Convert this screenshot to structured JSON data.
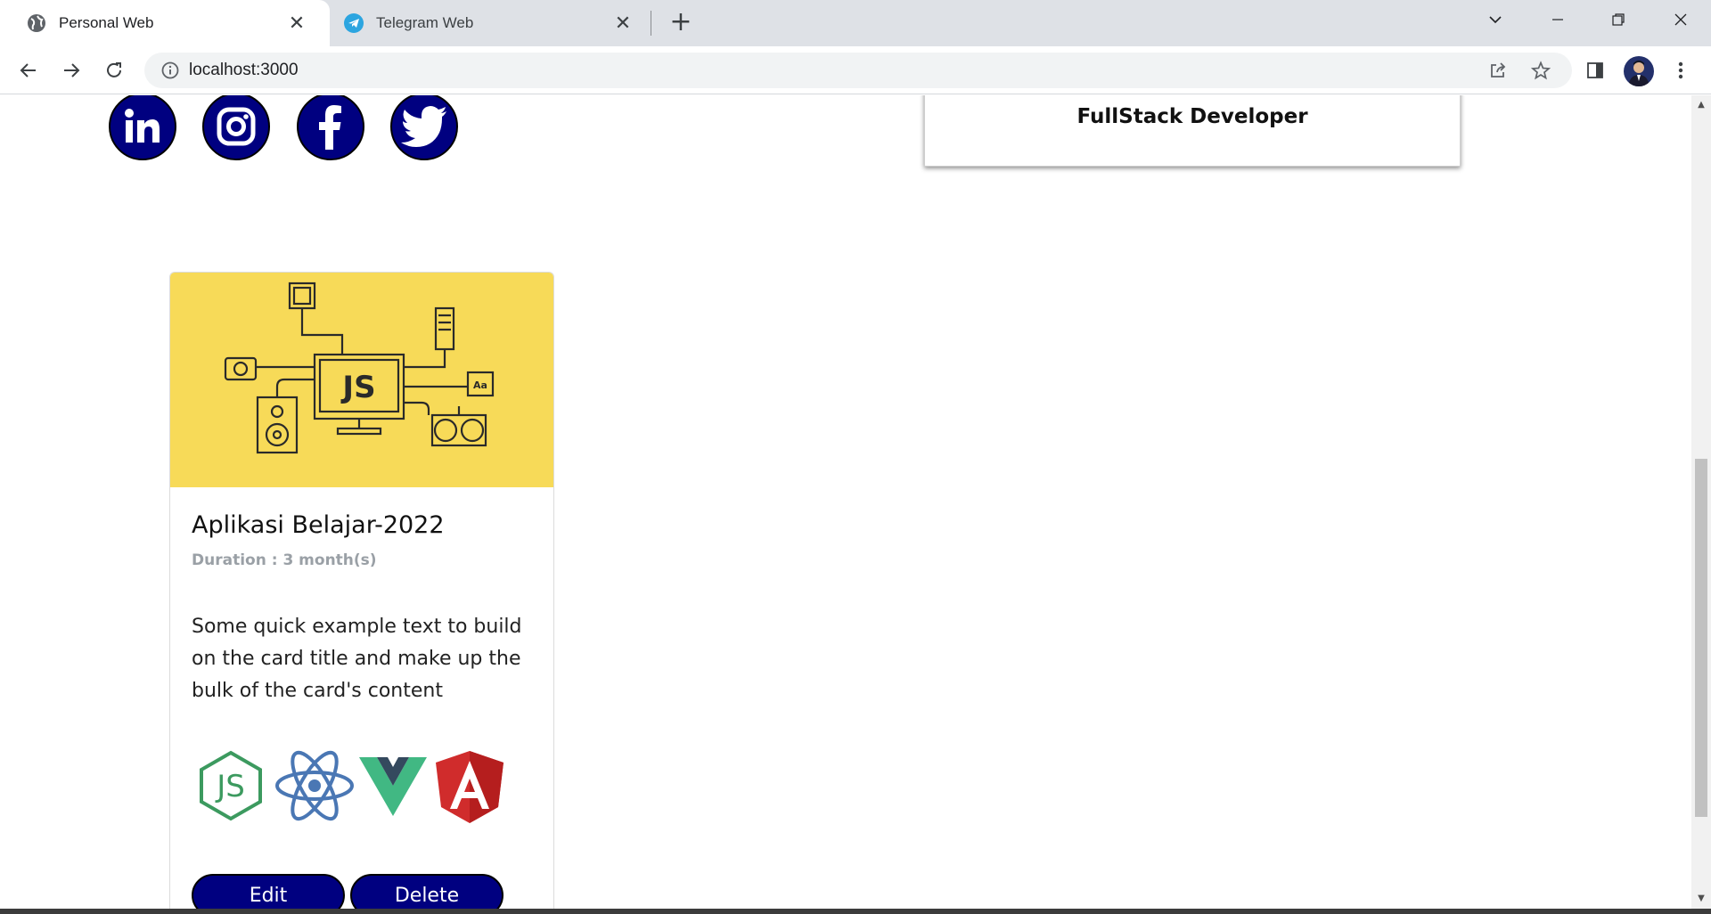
{
  "browser": {
    "tabs": [
      {
        "title": "Personal Web",
        "active": true,
        "favicon": "globe-icon"
      },
      {
        "title": "Telegram Web",
        "active": false,
        "favicon": "telegram-icon"
      }
    ],
    "url": "localhost:3000",
    "colors": {
      "tabstrip": "#dee1e6",
      "omnibox": "#f1f3f4"
    }
  },
  "page": {
    "social_icons": [
      "linkedin-icon",
      "instagram-icon",
      "facebook-icon",
      "twitter-icon"
    ],
    "role_card": {
      "text": "FullStack Developer"
    },
    "project": {
      "title": "Aplikasi Belajar-2022",
      "duration": "Duration : 3 month(s)",
      "description": "Some quick example text to build on the card title and make up the bulk of the card's content",
      "image_label": "JS",
      "technologies": [
        "nodejs-icon",
        "react-icon",
        "vue-icon",
        "angular-icon"
      ],
      "edit_label": "Edit",
      "delete_label": "Delete"
    },
    "colors": {
      "button": "#000080",
      "card_image_bg": "#f7da58",
      "muted_text": "#9aa0a6"
    }
  }
}
